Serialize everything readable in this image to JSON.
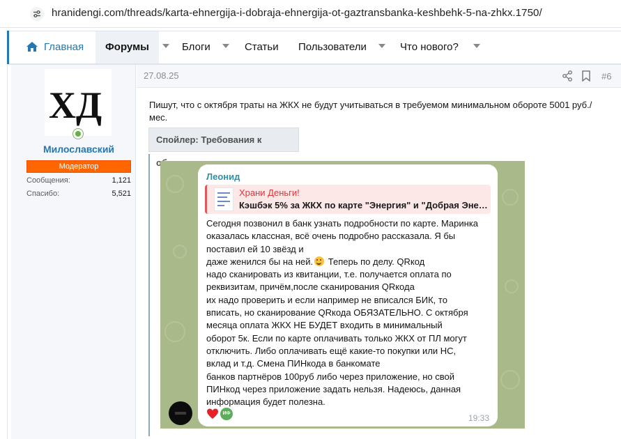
{
  "browser": {
    "url": "hranidengi.com/threads/karta-ehnergija-i-dobraja-ehnergija-ot-gaztransbanka-keshbehk-5-na-zhkx.1750/"
  },
  "nav": {
    "home": "Главная",
    "forums": "Форумы",
    "blogs": "Блоги",
    "articles": "Статьи",
    "users": "Пользователи",
    "whats_new": "Что нового?"
  },
  "author": {
    "avatar_text": "ХД",
    "name": "Милославский",
    "role": "Модератор",
    "stats": [
      {
        "label": "Сообщения:",
        "value": "1,121"
      },
      {
        "label": "Спасибо:",
        "value": "5,521"
      }
    ]
  },
  "post": {
    "date": "27.08.25",
    "number": "#6",
    "text_line1": "Пишут, что с октября траты на ЖКХ не будут учитываться в требуемом минимальном обороте 5001 руб./",
    "text_line2": "мес.",
    "spoiler_title": "Спойлер: Требования к обороту"
  },
  "telegram": {
    "sender": "Леонид",
    "quote_title": "Храни Деньги!",
    "quote_text": "Кэшбэк 5% за ЖКХ по карте \"Энергия\" и \"Добрая Эне…",
    "lines": [
      "Сегодня позвонил в банк узнать подробности по карте. Маринка",
      "оказалась классная, всё очень подробно рассказала. Я бы",
      "поставил ей 10 звёзд и",
      "даже женился бы на ней.",
      " Теперь по делу. QRкод",
      "надо сканировать из квитанции, т.е. получается оплата по",
      "реквизитам, причём,после сканирования QRкода",
      "их надо проверить и если например не вписался БИК, то",
      "вписать, но сканирование QRкода ОБЯЗАТЕЛЬНО. С октября",
      "месяца оплата ЖКХ НЕ БУДЕТ входить в минимальный",
      "оборот 5к. Если по карте оплачивать только ЖКХ от ПЛ могут",
      "отключить. Либо оплачивать ещё какие-то покупки или НС,",
      "вклад и т.д. Смена ПИНкода в банкомате",
      "банков партнёров 100руб либо через приложение, но свой",
      "ПИНкод через приложение задать нельзя. Надеюсь, данная",
      "информация будет полезна."
    ],
    "reaction_avatar": "ИФ",
    "time": "19:33"
  },
  "colors": {
    "accent": "#2577b1",
    "role_badge": "#ff6600",
    "telegram_bg": "#aab98a",
    "quote_accent": "#e0595a"
  }
}
